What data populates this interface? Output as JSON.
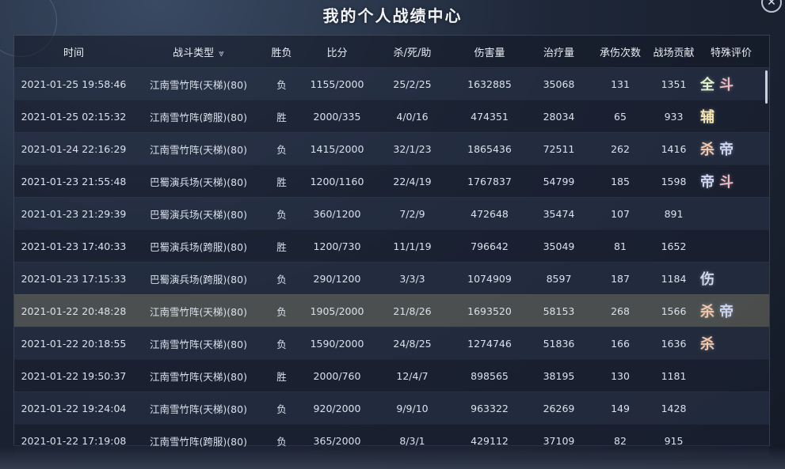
{
  "window": {
    "title": "我的个人战绩中心",
    "close_glyph": "✕"
  },
  "headers": [
    "时间",
    "战斗类型",
    "胜负",
    "比分",
    "杀/死/助",
    "伤害量",
    "治疗量",
    "承伤次数",
    "战场贡献",
    "特殊评价"
  ],
  "filter_glyph": "⩔",
  "rows": [
    {
      "time": "2021-01-25 19:58:46",
      "type": "江南雪竹阵(天梯)(80)",
      "result": "负",
      "score": "1155/2000",
      "kda": "25/2/25",
      "damage": "1632885",
      "heal": "35068",
      "hits": "131",
      "contrib": "1351",
      "evals": [
        {
          "t": "全",
          "c": "#dff3c8"
        },
        {
          "t": "斗",
          "c": "#f2b7c0"
        }
      ]
    },
    {
      "time": "2021-01-25 02:15:32",
      "type": "江南雪竹阵(跨服)(80)",
      "result": "胜",
      "score": "2000/335",
      "kda": "4/0/16",
      "damage": "474351",
      "heal": "28034",
      "hits": "65",
      "contrib": "933",
      "evals": [
        {
          "t": "辅",
          "c": "#f5e6b0"
        }
      ]
    },
    {
      "time": "2021-01-24 22:16:29",
      "type": "江南雪竹阵(天梯)(80)",
      "result": "负",
      "score": "1415/2000",
      "kda": "32/1/23",
      "damage": "1865436",
      "heal": "72511",
      "hits": "262",
      "contrib": "1416",
      "evals": [
        {
          "t": "杀",
          "c": "#f3c7a8"
        },
        {
          "t": "帝",
          "c": "#c9d4f3"
        }
      ]
    },
    {
      "time": "2021-01-23 21:55:48",
      "type": "巴蜀演兵场(天梯)(80)",
      "result": "胜",
      "score": "1200/1160",
      "kda": "22/4/19",
      "damage": "1767837",
      "heal": "54799",
      "hits": "185",
      "contrib": "1598",
      "evals": [
        {
          "t": "帝",
          "c": "#c9d4f3"
        },
        {
          "t": "斗",
          "c": "#f2b7c0"
        }
      ]
    },
    {
      "time": "2021-01-23 21:29:39",
      "type": "巴蜀演兵场(天梯)(80)",
      "result": "负",
      "score": "360/1200",
      "kda": "7/2/9",
      "damage": "472648",
      "heal": "35474",
      "hits": "107",
      "contrib": "891",
      "evals": []
    },
    {
      "time": "2021-01-23 17:40:33",
      "type": "巴蜀演兵场(跨服)(80)",
      "result": "胜",
      "score": "1200/730",
      "kda": "11/1/19",
      "damage": "796642",
      "heal": "35049",
      "hits": "81",
      "contrib": "1652",
      "evals": []
    },
    {
      "time": "2021-01-23 17:15:33",
      "type": "巴蜀演兵场(跨服)(80)",
      "result": "负",
      "score": "290/1200",
      "kda": "3/3/3",
      "damage": "1074909",
      "heal": "8597",
      "hits": "187",
      "contrib": "1184",
      "evals": [
        {
          "t": "伤",
          "c": "#cdd6ee"
        }
      ]
    },
    {
      "time": "2021-01-22 20:48:28",
      "type": "江南雪竹阵(天梯)(80)",
      "result": "负",
      "score": "1905/2000",
      "kda": "21/8/26",
      "damage": "1693520",
      "heal": "58153",
      "hits": "268",
      "contrib": "1566",
      "evals": [
        {
          "t": "杀",
          "c": "#f3c7a8"
        },
        {
          "t": "帝",
          "c": "#c9d4f3"
        }
      ]
    },
    {
      "time": "2021-01-22 20:18:55",
      "type": "江南雪竹阵(天梯)(80)",
      "result": "负",
      "score": "1590/2000",
      "kda": "24/8/25",
      "damage": "1274746",
      "heal": "51836",
      "hits": "166",
      "contrib": "1636",
      "evals": [
        {
          "t": "杀",
          "c": "#f3c7a8"
        }
      ]
    },
    {
      "time": "2021-01-22 19:50:37",
      "type": "江南雪竹阵(天梯)(80)",
      "result": "胜",
      "score": "2000/760",
      "kda": "12/4/7",
      "damage": "898565",
      "heal": "38195",
      "hits": "130",
      "contrib": "1181",
      "evals": []
    },
    {
      "time": "2021-01-22 19:24:04",
      "type": "江南雪竹阵(天梯)(80)",
      "result": "负",
      "score": "920/2000",
      "kda": "9/9/10",
      "damage": "963322",
      "heal": "26269",
      "hits": "149",
      "contrib": "1428",
      "evals": []
    },
    {
      "time": "2021-01-22 17:19:08",
      "type": "江南雪竹阵(跨服)(80)",
      "result": "负",
      "score": "365/2000",
      "kda": "8/3/1",
      "damage": "429112",
      "heal": "37109",
      "hits": "82",
      "contrib": "915",
      "evals": []
    }
  ],
  "highlight_row_index": 7
}
